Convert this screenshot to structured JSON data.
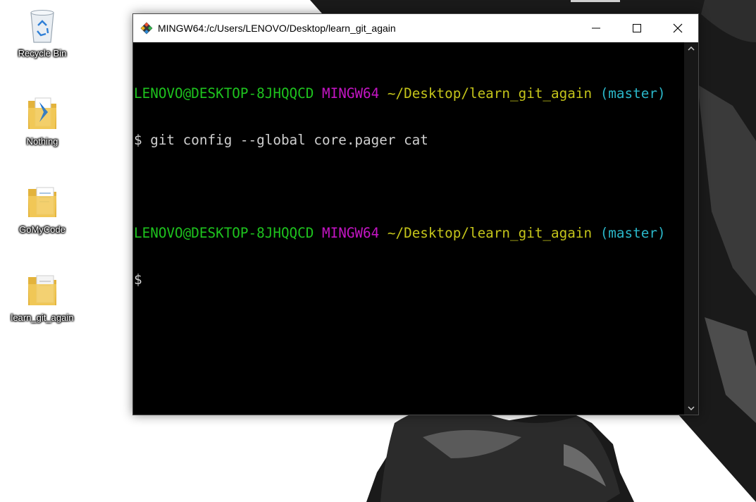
{
  "desktop": {
    "icons": [
      {
        "label": "Recycle Bin"
      },
      {
        "label": "Nothing"
      },
      {
        "label": "GoMyCode"
      },
      {
        "label": "learn_git_again"
      }
    ]
  },
  "window": {
    "title": "MINGW64:/c/Users/LENOVO/Desktop/learn_git_again",
    "controls": {
      "minimize": "—",
      "maximize": "☐",
      "close": "✕"
    }
  },
  "terminal": {
    "prompt1": {
      "user_host": "LENOVO@DESKTOP-8JHQQCD",
      "system": "MINGW64",
      "path": "~/Desktop/learn_git_again",
      "branch": "(master)"
    },
    "command1": "$ git config --global core.pager cat",
    "prompt2": {
      "user_host": "LENOVO@DESKTOP-8JHQQCD",
      "system": "MINGW64",
      "path": "~/Desktop/learn_git_again",
      "branch": "(master)"
    },
    "command2": "$"
  },
  "colors": {
    "user_host": "#1ec31e",
    "system": "#c415c4",
    "path": "#c4c41a",
    "branch": "#2ab6c8",
    "text": "#cfcfcf"
  }
}
